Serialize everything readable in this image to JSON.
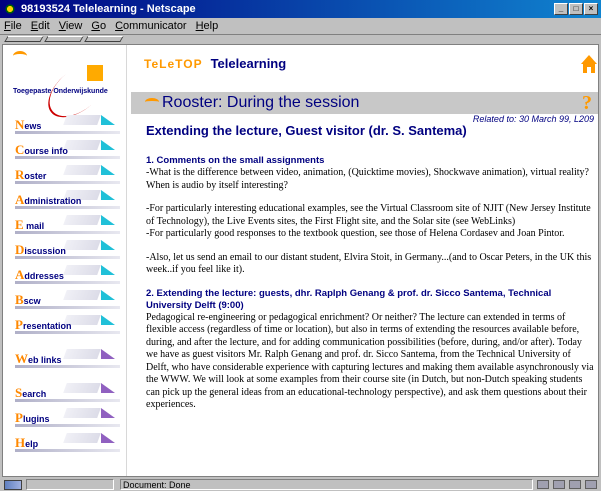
{
  "window": {
    "title": "98193524 Telelearning - Netscape",
    "buttons": [
      "_",
      "□",
      "×"
    ]
  },
  "menu": [
    "File",
    "Edit",
    "View",
    "Go",
    "Communicator",
    "Help"
  ],
  "logo": {
    "text": "Toegepaste Onderwijskunde"
  },
  "nav": [
    {
      "cap": "N",
      "rest": "ews"
    },
    {
      "cap": "C",
      "rest": "ourse info"
    },
    {
      "cap": "R",
      "rest": "oster"
    },
    {
      "cap": "A",
      "rest": "dministration"
    },
    {
      "cap": "E",
      "rest": " mail"
    },
    {
      "cap": "D",
      "rest": "iscussion"
    },
    {
      "cap": "A",
      "rest": "ddresses"
    },
    {
      "cap": "B",
      "rest": "scw"
    },
    {
      "cap": "P",
      "rest": "resentation"
    },
    {
      "cap": "W",
      "rest": "eb links"
    },
    {
      "cap": "S",
      "rest": "earch"
    },
    {
      "cap": "P",
      "rest": "lugins"
    },
    {
      "cap": "H",
      "rest": "elp"
    }
  ],
  "brand": {
    "logo": "TeLeTOP",
    "title": "Telelearning"
  },
  "section": {
    "title": "Rooster: During the session",
    "help": "?"
  },
  "related": "Related to: 30 March 99, L209",
  "heading": "Extending the lecture, Guest visitor (dr. S. Santema)",
  "content": {
    "h1": "1. Comments on the small assignments",
    "p1": "-What is the difference between video, animation, (Quicktime movies), Shockwave animation), virtual reality? When is audio by itself interesting?",
    "p2": "-For particularly interesting educational examples, see the Virtual Classroom site of NJIT (New Jersey Institute of Technology), the Live Events sites, the First Flight site, and the Solar site (see WebLinks)",
    "p3": "-For particularly good responses to the textbook question, see those of Helena Cordasev and Joan Pintor.",
    "p4": "-Also, let us send an email to our distant student, Elvira Stoit, in Germany...(and to Oscar Peters, in the UK this week..if you feel like it).",
    "h2": "2. Extending the lecture: guests, dhr. Raplph Genang & prof. dr. Sicco Santema, Technical University Delft (9:00)",
    "p5": "Pedagogical re-engineering or pedagogical enrichment? Or neither? The lecture can extended in terms of flexible access (regardless of time or location), but also in terms of extending the resources available before, during, and after the lecture, and for adding communication possibilities (before, during, and/or after). Today we have as guest visitors Mr. Ralph Genang and prof. dr. Sicco Santema, from the Technical University of Delft, who have considerable experience with capturing lectures and making them available asynchronously via the WWW. We will look at some examples from their course site (in Dutch, but non-Dutch speaking students can pick up the general ideas from an educational-technology perspective), and ask them questions about their experiences."
  },
  "status": {
    "text": "Document: Done"
  }
}
